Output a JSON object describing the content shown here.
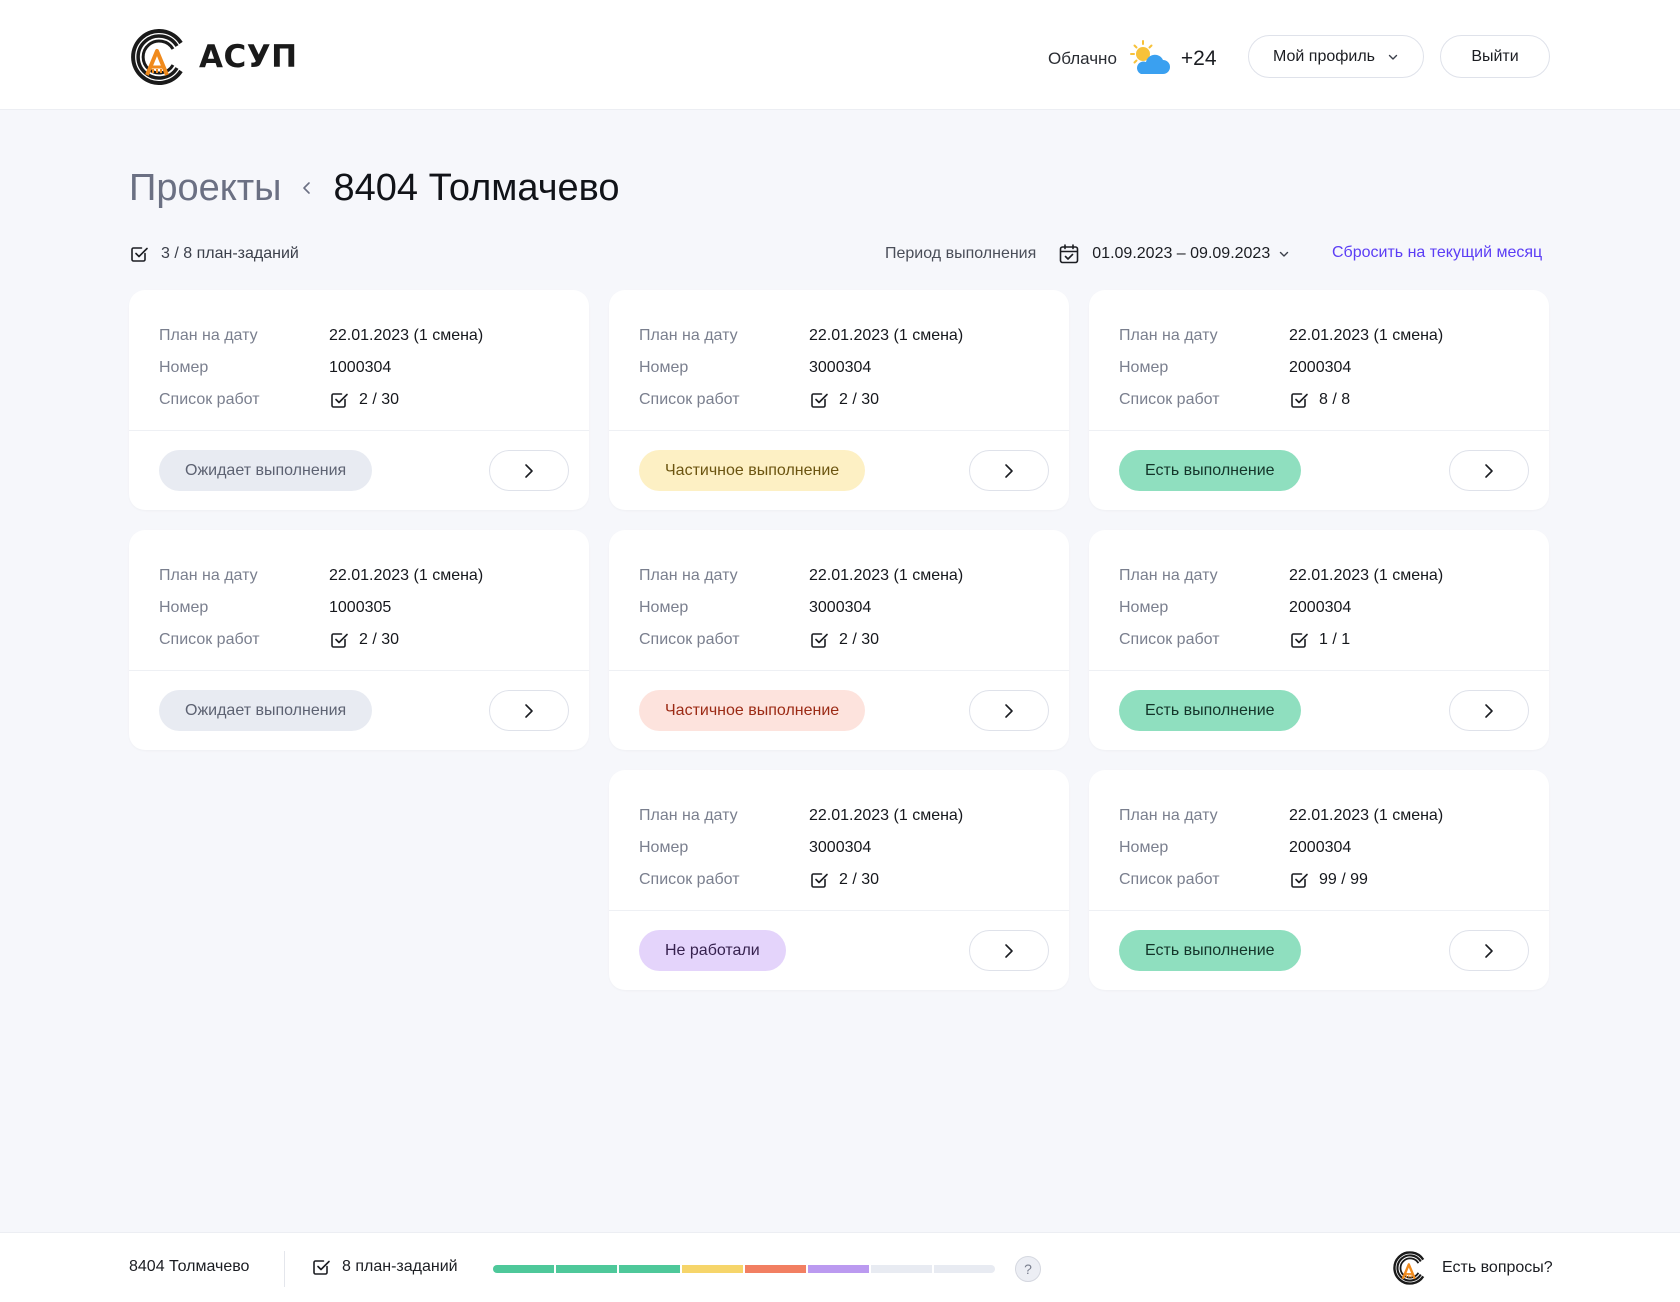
{
  "header": {
    "logo_text": "АСУП",
    "weather_text": "Облачно",
    "weather_icon": "partly-cloudy-icon",
    "temperature": "+24",
    "profile_label": "Мой профиль",
    "logout_label": "Выйти"
  },
  "breadcrumb": {
    "parent": "Проекты",
    "current": "8404 Толмачево"
  },
  "toolbar": {
    "tasks_count": "3 / 8 план-заданий",
    "period_label": "Период выполнения",
    "period_value": "01.09.2023 – 09.09.2023",
    "reset_label": "Сбросить на текущий месяц"
  },
  "card_labels": {
    "date": "План на дату",
    "number": "Номер",
    "works": "Список работ"
  },
  "cards": [
    {
      "date": "22.01.2023 (1 смена)",
      "number": "1000304",
      "works": "2 / 30",
      "status": "Ожидает выполнения",
      "status_kind": "waiting"
    },
    {
      "date": "22.01.2023 (1 смена)",
      "number": "3000304",
      "works": "2 / 30",
      "status": "Частичное выполнение",
      "status_kind": "partial-yellow"
    },
    {
      "date": "22.01.2023 (1 смена)",
      "number": "2000304",
      "works": "8 / 8",
      "status": "Есть выполнение",
      "status_kind": "done"
    },
    {
      "date": "22.01.2023 (1 смена)",
      "number": "1000305",
      "works": "2 / 30",
      "status": "Ожидает выполнения",
      "status_kind": "waiting"
    },
    {
      "date": "22.01.2023 (1 смена)",
      "number": "3000304",
      "works": "2 / 30",
      "status": "Частичное выполнение",
      "status_kind": "partial-red"
    },
    {
      "date": "22.01.2023 (1 смена)",
      "number": "2000304",
      "works": "1 / 1",
      "status": "Есть выполнение",
      "status_kind": "done"
    },
    {
      "date": "22.01.2023 (1 смена)",
      "number": "3000304",
      "works": "2 / 30",
      "status": "Не работали",
      "status_kind": "not-worked"
    },
    {
      "date": "22.01.2023 (1 смена)",
      "number": "2000304",
      "works": "99 / 99",
      "status": "Есть выполнение",
      "status_kind": "done"
    }
  ],
  "status_colors": {
    "waiting": {
      "bg": "#e8ebf2",
      "fg": "#5d6272"
    },
    "partial-yellow": {
      "bg": "#fdf0c4",
      "fg": "#6b5410"
    },
    "done": {
      "bg": "#8fdfbf",
      "fg": "#14352a"
    },
    "partial-red": {
      "bg": "#fde3dd",
      "fg": "#9b2a14"
    },
    "not-worked": {
      "bg": "#e4d4fb",
      "fg": "#36214e"
    }
  },
  "footer": {
    "project": "8404 Толмачево",
    "tasks_total": "8 план-заданий",
    "help_symbol": "?",
    "questions_label": "Есть вопросы?",
    "progress_segments": [
      "#4ec89a",
      "#4ec89a",
      "#4ec89a",
      "#f6d56a",
      "#f27f62",
      "#bb9af0",
      "#e8ebf2",
      "#e8ebf2"
    ]
  },
  "accent_color": "#5b3df5"
}
